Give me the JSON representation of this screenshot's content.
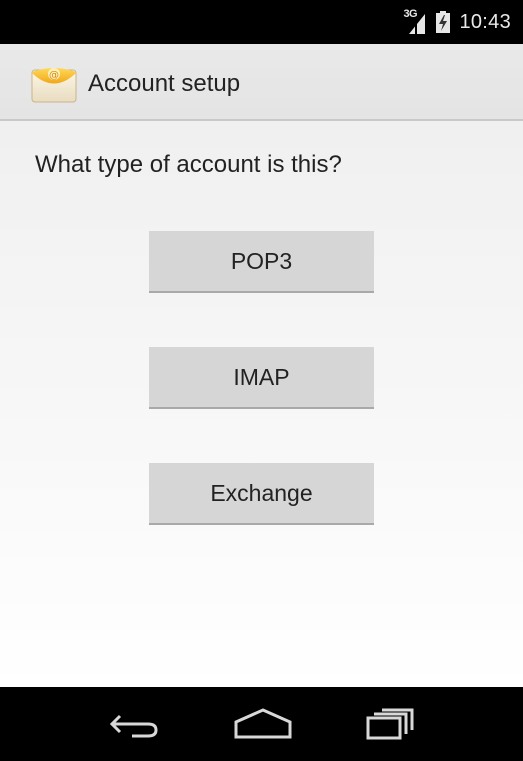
{
  "status_bar": {
    "network_type": "3G",
    "time": "10:43",
    "icons": [
      "signal-icon",
      "battery-icon"
    ]
  },
  "action_bar": {
    "title": "Account setup",
    "icon": "email-app-icon"
  },
  "main": {
    "question": "What type of account is this?",
    "options": [
      {
        "label": "POP3"
      },
      {
        "label": "IMAP"
      },
      {
        "label": "Exchange"
      }
    ]
  },
  "nav_bar": {
    "icons": [
      "back-icon",
      "home-icon",
      "recents-icon"
    ]
  },
  "colors": {
    "status_bar_bg": "#000000",
    "action_bar_bg": "#e6e6e6",
    "button_bg": "#d6d6d6",
    "text": "#222222"
  }
}
